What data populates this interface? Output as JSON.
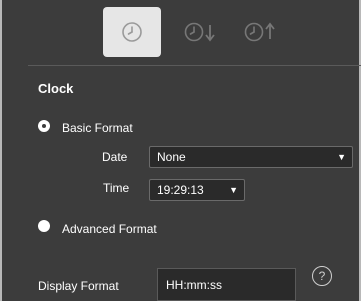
{
  "toolbar": {
    "buttons": [
      {
        "name": "clock",
        "icon": "clock-icon",
        "active": true
      },
      {
        "name": "count-down",
        "icon": "clock-down-arrow-icon",
        "active": false
      },
      {
        "name": "count-up",
        "icon": "clock-up-arrow-icon",
        "active": false
      }
    ]
  },
  "section": {
    "title": "Clock"
  },
  "options": {
    "basic_label": "Basic Format",
    "advanced_label": "Advanced Format",
    "selected": "basic"
  },
  "date": {
    "label": "Date",
    "value": "None"
  },
  "time": {
    "label": "Time",
    "value": "19:29:13"
  },
  "display_format": {
    "label": "Display Format",
    "value": "HH:mm:ss"
  },
  "help": {
    "glyph": "?"
  },
  "colors": {
    "background": "#3c3c3c",
    "active_button": "#e6e6e6",
    "input_bg": "#2a2a2a"
  }
}
